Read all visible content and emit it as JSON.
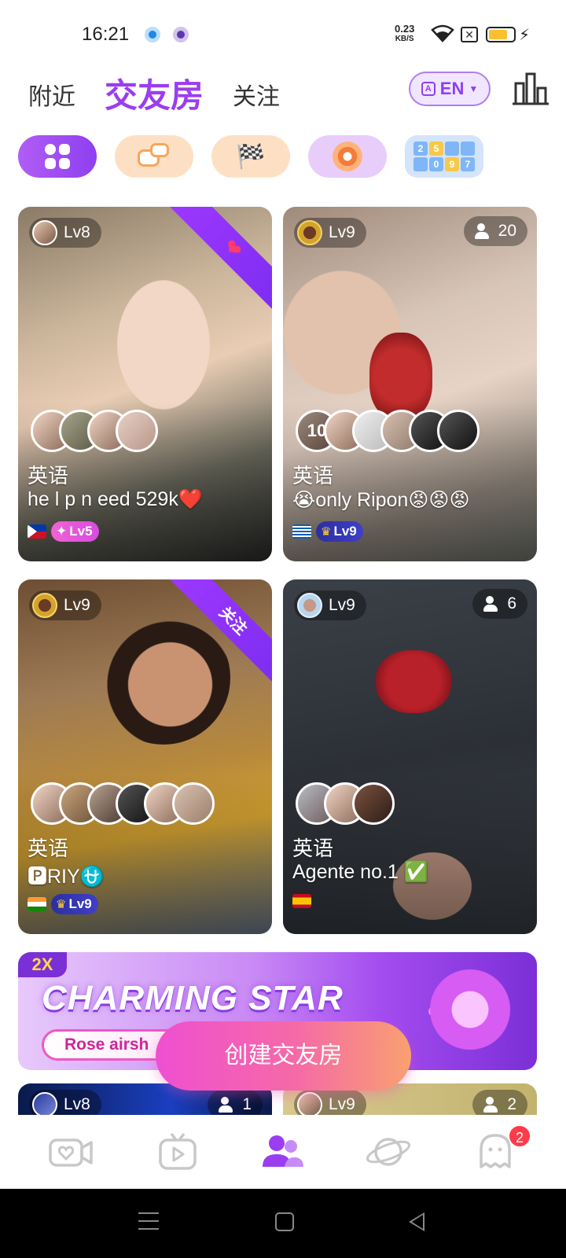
{
  "status_bar": {
    "time": "16:21",
    "net_speed": "0.23",
    "net_unit": "KB/S",
    "x_label": "✕"
  },
  "top_tabs": {
    "nearby": "附近",
    "party_room": "交友房",
    "following": "关注",
    "language": "EN"
  },
  "categories": [
    {
      "name": "all",
      "icon": "grid-icon"
    },
    {
      "name": "chat",
      "icon": "chat-bubbles-icon"
    },
    {
      "name": "racing",
      "icon": "racing-flags-icon"
    },
    {
      "name": "wheel",
      "icon": "spin-wheel-icon"
    },
    {
      "name": "numbers",
      "icon": "number-puzzle-icon",
      "digits": [
        "2",
        "5",
        "",
        "",
        "",
        "0",
        "9",
        "",
        "7",
        ""
      ]
    }
  ],
  "rooms": [
    {
      "level": "Lv8",
      "ribbon": "❤",
      "language": "英语",
      "title": "he l p n eed 529k❤️",
      "flag": "ph",
      "user_level": "Lv5",
      "user_level_icon": "✦"
    },
    {
      "level": "Lv9",
      "count": "20",
      "avatar_count": "10",
      "language": "英语",
      "title": "😭only Ripon😡😡😡",
      "flag": "gr",
      "user_level": "Lv9",
      "user_level_icon": "♛"
    },
    {
      "level": "Lv9",
      "ribbon": "关注",
      "language": "英语",
      "title": "🅿RIY⛎",
      "flag": "in",
      "user_level": "Lv9",
      "user_level_icon": "♛"
    },
    {
      "level": "Lv9",
      "count": "6",
      "language": "英语",
      "title": "Agente no.1 ✅",
      "flag": "es"
    },
    {
      "level": "Lv8",
      "count": "1"
    },
    {
      "level": "Lv9",
      "count": "2"
    }
  ],
  "banner": {
    "multiplier": "2X",
    "title": "CHARMING STAR",
    "subtitle": "Rose airsh"
  },
  "create_button": "创建交友房",
  "bottom_nav": {
    "items": [
      "video-heart-icon",
      "tv-play-icon",
      "group-icon",
      "planet-icon",
      "ghost-chat-icon"
    ],
    "badge": "2"
  },
  "colors": {
    "accent": "#9b3df0",
    "create_gradient_start": "#f04fd1",
    "create_gradient_end": "#f9a070"
  }
}
